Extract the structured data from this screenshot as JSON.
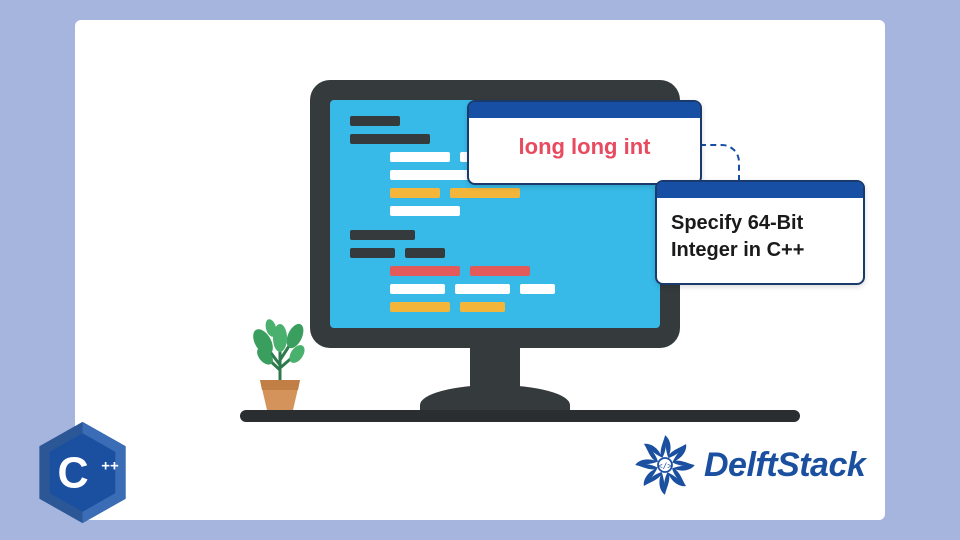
{
  "card1": {
    "text": "long long int"
  },
  "card2": {
    "line1": "Specify 64-Bit",
    "line2": "Integer in C++"
  },
  "brand": {
    "name": "DelftStack"
  },
  "cpp": {
    "label": "C++"
  },
  "colors": {
    "bg": "#a6b5de",
    "accent_blue": "#164fa3",
    "accent_red": "#e84a5f",
    "screen": "#38bae8",
    "bezel": "#353a3d"
  }
}
